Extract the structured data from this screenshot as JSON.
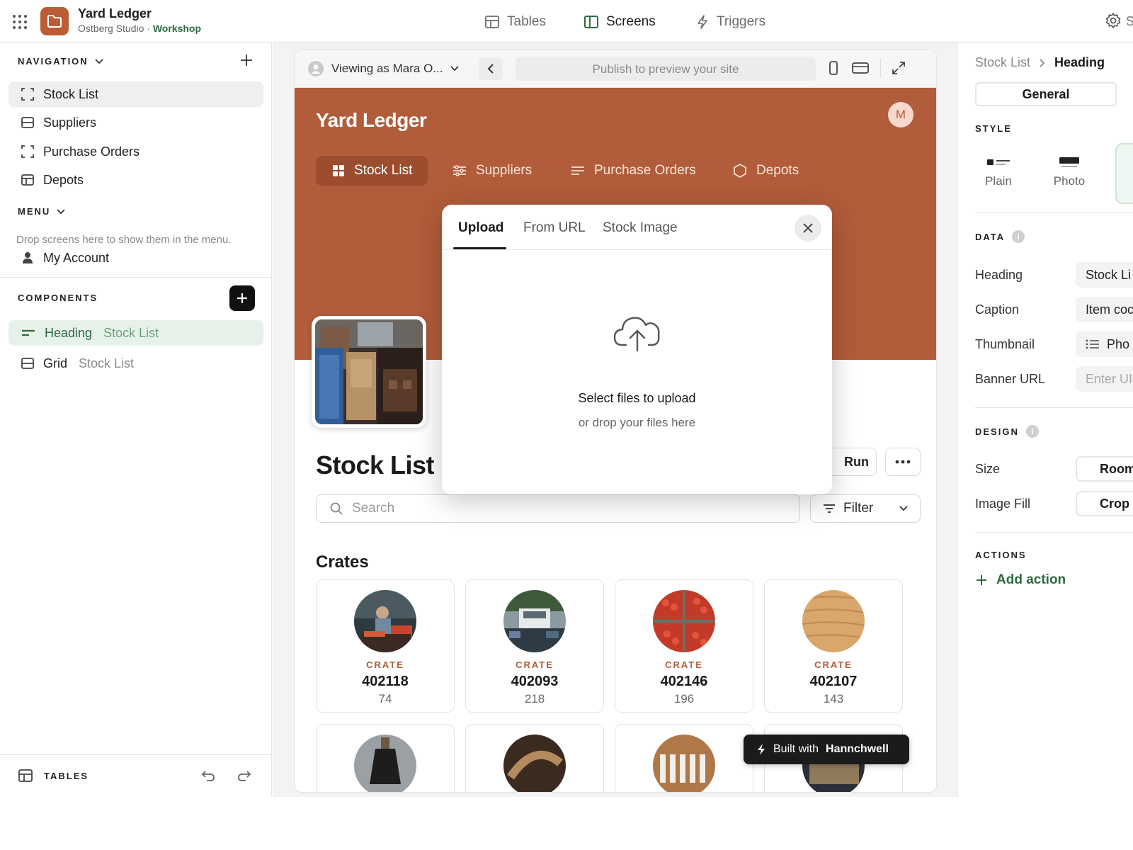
{
  "app": {
    "title": "Yard Ledger",
    "org": "Ostberg Studio ·",
    "workspace": "Workshop",
    "brand_color": "#bd5b34"
  },
  "topnav": {
    "tabs": [
      {
        "label": "Tables",
        "icon": "table-icon",
        "active": false
      },
      {
        "label": "Screens",
        "icon": "screens-icon",
        "active": true
      },
      {
        "label": "Triggers",
        "icon": "bolt-icon",
        "active": false
      }
    ],
    "settings_label": "S"
  },
  "sidebar": {
    "navigation_title": "NAVIGATION",
    "nav_items": [
      {
        "label": "Stock List",
        "icon": "screen-frame-icon",
        "selected": true
      },
      {
        "label": "Suppliers",
        "icon": "table-screen-icon",
        "selected": false
      },
      {
        "label": "Purchase Orders",
        "icon": "screen-frame-icon",
        "selected": false
      },
      {
        "label": "Depots",
        "icon": "grid-screen-icon",
        "selected": false
      }
    ],
    "menu_title": "MENU",
    "menu_hint": "Drop screens here to show them in the menu.",
    "menu_items": [
      {
        "label": "My Account",
        "icon": "person-icon"
      }
    ],
    "components_title": "COMPONENTS",
    "components": [
      {
        "label": "Heading",
        "context": "Stock List",
        "icon": "heading-icon",
        "selected": true
      },
      {
        "label": "Grid",
        "context": "Stock List",
        "icon": "grid-component-icon",
        "selected": false
      }
    ],
    "footer_label": "TABLES"
  },
  "preview": {
    "viewing_as": "Viewing as Mara O...",
    "publish_hint": "Publish to preview your site",
    "site_title": "Yard Ledger",
    "user_initial": "M",
    "header_color": "#b15c3a",
    "site_nav": [
      {
        "label": "Stock List",
        "icon": "grid-four-icon",
        "active": true
      },
      {
        "label": "Suppliers",
        "icon": "sliders-icon",
        "active": false
      },
      {
        "label": "Purchase Orders",
        "icon": "lines-icon",
        "active": false
      },
      {
        "label": "Depots",
        "icon": "hexagon-icon",
        "active": false
      }
    ],
    "heading": "Stock List",
    "run_label": "Run",
    "search_placeholder": "Search",
    "filter_label": "Filter",
    "grid_title": "Crates",
    "cards": [
      {
        "tag": "CRATE",
        "number": "402118",
        "qty": "74"
      },
      {
        "tag": "CRATE",
        "number": "402093",
        "qty": "218"
      },
      {
        "tag": "CRATE",
        "number": "402146",
        "qty": "196"
      },
      {
        "tag": "CRATE",
        "number": "402107",
        "qty": "143"
      }
    ],
    "built_with_prefix": "Built with",
    "built_with_brand": "Hannchwell"
  },
  "modal": {
    "tabs": [
      "Upload",
      "From URL",
      "Stock Image"
    ],
    "active_tab": "Upload",
    "upload_title": "Select files to upload",
    "upload_subtitle": "or drop your files here"
  },
  "inspector": {
    "breadcrumb_parent": "Stock List",
    "breadcrumb_current": "Heading",
    "tab_label": "General",
    "style_title": "STYLE",
    "style_options": [
      "Plain",
      "Photo"
    ],
    "data_title": "DATA",
    "data_fields": [
      {
        "label": "Heading",
        "value": "Stock Li"
      },
      {
        "label": "Caption",
        "value": "Item coc"
      },
      {
        "label": "Thumbnail",
        "value": "Pho"
      },
      {
        "label": "Banner URL",
        "value": "Enter UI"
      }
    ],
    "design_title": "DESIGN",
    "design_fields": [
      {
        "label": "Size",
        "value": "Room"
      },
      {
        "label": "Image Fill",
        "value": "Crop"
      }
    ],
    "actions_title": "ACTIONS",
    "add_action_label": "Add action",
    "accent_green": "#2f6b3f"
  }
}
